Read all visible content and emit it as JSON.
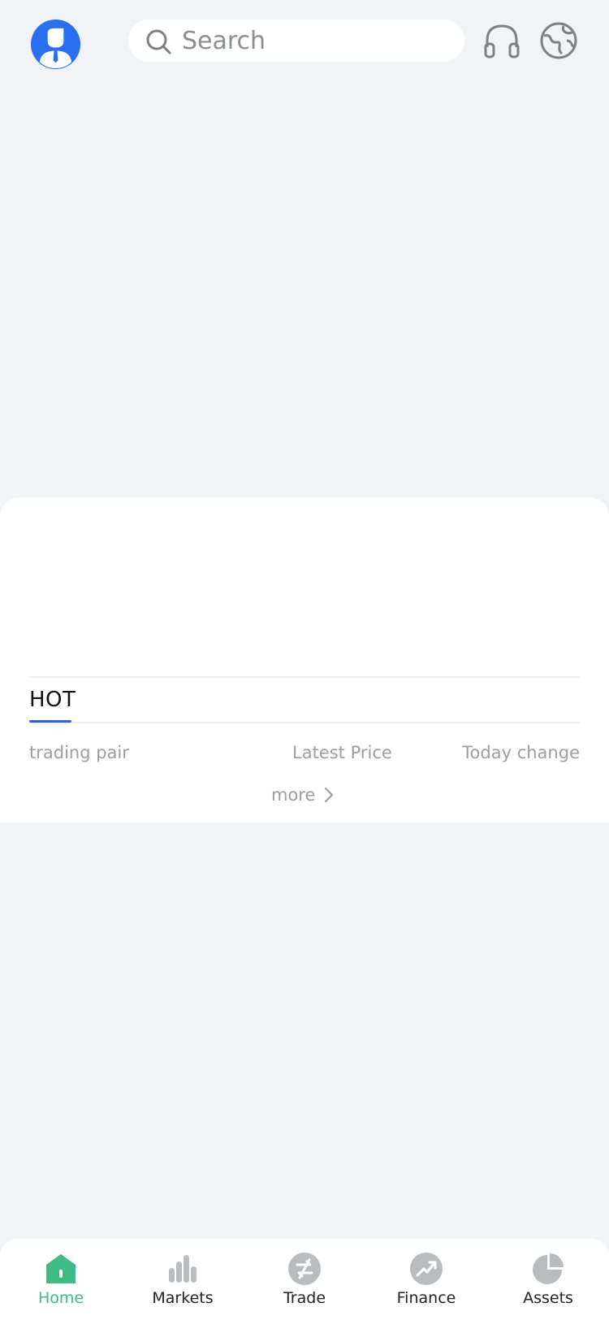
{
  "header": {
    "search_placeholder": "Search"
  },
  "hot": {
    "tab_label": "HOT",
    "columns": {
      "pair": "trading pair",
      "price": "Latest Price",
      "change": "Today change"
    },
    "more_label": "more"
  },
  "tabbar": {
    "items": [
      {
        "label": "Home",
        "icon": "home-icon",
        "active": true
      },
      {
        "label": "Markets",
        "icon": "bar-chart-icon",
        "active": false
      },
      {
        "label": "Trade",
        "icon": "trade-icon",
        "active": false
      },
      {
        "label": "Finance",
        "icon": "trend-up-icon",
        "active": false
      },
      {
        "label": "Assets",
        "icon": "pie-chart-icon",
        "active": false
      }
    ]
  },
  "colors": {
    "accent_blue": "#2a63d6",
    "active_green": "#3dbb83",
    "inactive_icon": "#b9bcbf",
    "background": "#f1f4f6"
  }
}
